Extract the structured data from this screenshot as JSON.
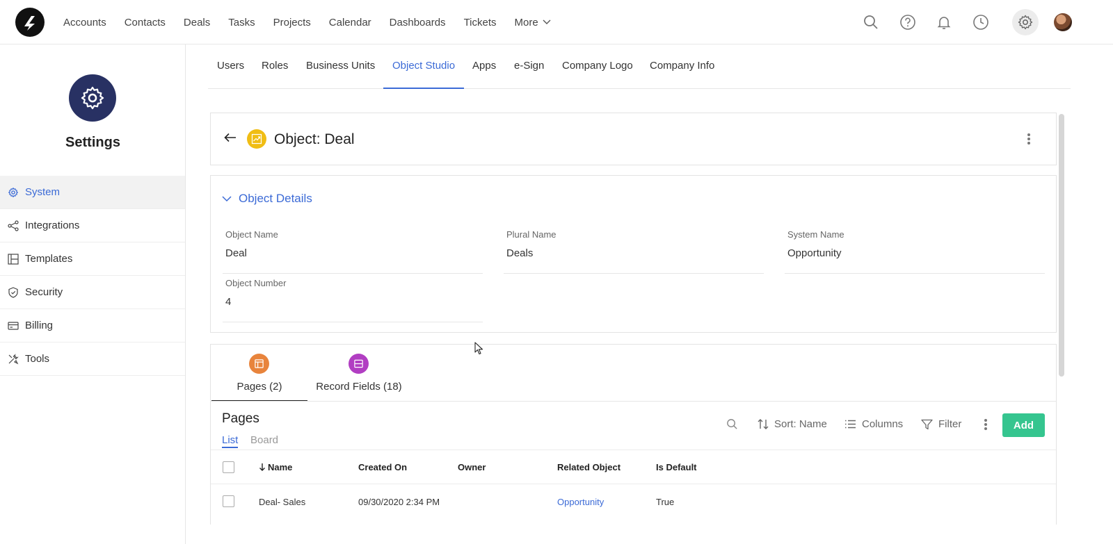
{
  "topnav": {
    "links": [
      "Accounts",
      "Contacts",
      "Deals",
      "Tasks",
      "Projects",
      "Calendar",
      "Dashboards",
      "Tickets"
    ],
    "more_label": "More"
  },
  "sidebar": {
    "title": "Settings",
    "items": [
      {
        "label": "System",
        "icon": "gear-icon",
        "active": true
      },
      {
        "label": "Integrations",
        "icon": "share-icon"
      },
      {
        "label": "Templates",
        "icon": "layout-icon"
      },
      {
        "label": "Security",
        "icon": "shield-icon"
      },
      {
        "label": "Billing",
        "icon": "card-icon"
      },
      {
        "label": "Tools",
        "icon": "tools-icon"
      }
    ]
  },
  "tabs": [
    "Users",
    "Roles",
    "Business Units",
    "Object Studio",
    "Apps",
    "e-Sign",
    "Company Logo",
    "Company Info"
  ],
  "active_tab": "Object Studio",
  "object": {
    "title": "Object: Deal",
    "icon_color": "#f0bd14"
  },
  "details": {
    "section_title": "Object Details",
    "fields": [
      {
        "label": "Object Name",
        "value": "Deal"
      },
      {
        "label": "Plural Name",
        "value": "Deals"
      },
      {
        "label": "System Name",
        "value": "Opportunity"
      },
      {
        "label": "Object Number",
        "value": "4"
      }
    ]
  },
  "subtabs": [
    {
      "label": "Pages (2)",
      "color": "#e8843c",
      "icon": "page-layout-icon",
      "active": true
    },
    {
      "label": "Record Fields (18)",
      "color": "#b13ec2",
      "icon": "record-fields-icon"
    }
  ],
  "list": {
    "title": "Pages",
    "views": [
      "List",
      "Board"
    ],
    "toolbar": {
      "sort_label": "Sort: Name",
      "columns_label": "Columns",
      "filter_label": "Filter",
      "add_label": "Add"
    },
    "columns": [
      "Name",
      "Created On",
      "Owner",
      "Related Object",
      "Is Default"
    ],
    "rows": [
      {
        "name": "Deal- Sales",
        "created_on": "09/30/2020 2:34 PM",
        "owner": "",
        "related_object": "Opportunity",
        "is_default": "True"
      }
    ]
  },
  "colors": {
    "accent": "#3b6ad6",
    "add_button": "#35c58f",
    "settings_badge": "#283163"
  }
}
